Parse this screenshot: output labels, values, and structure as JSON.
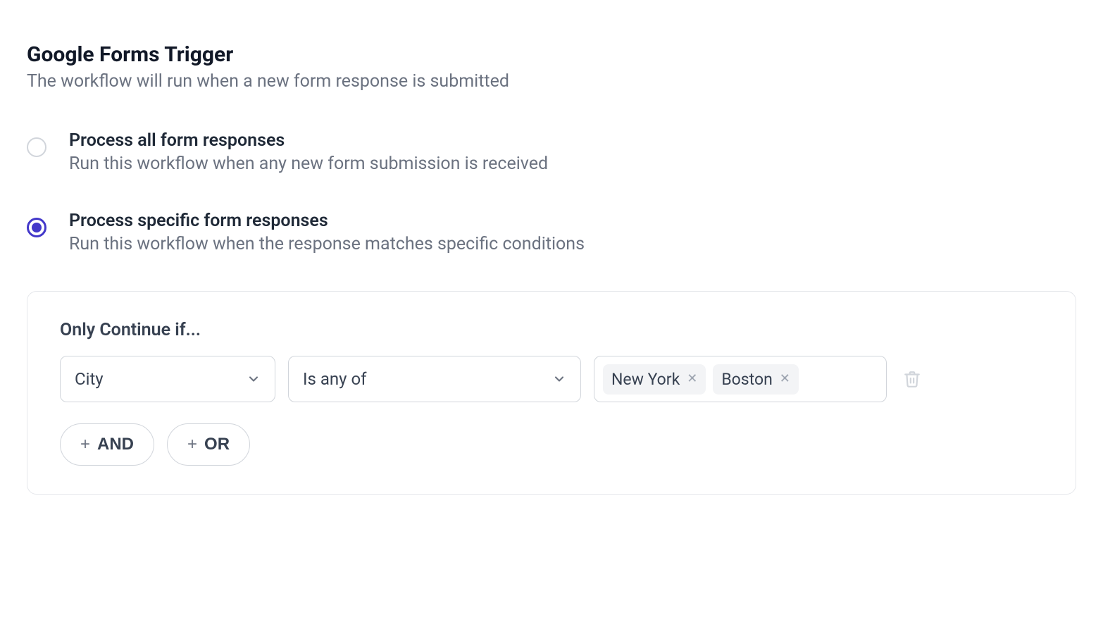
{
  "header": {
    "title": "Google Forms Trigger",
    "subtitle": "The workflow will run when a new form response is submitted"
  },
  "options": {
    "all": {
      "title": "Process all form responses",
      "desc": "Run this workflow when any new form submission is received",
      "selected": false
    },
    "specific": {
      "title": "Process specific form responses",
      "desc": "Run this workflow when the response matches specific conditions",
      "selected": true
    }
  },
  "conditions": {
    "panel_title": "Only Continue if...",
    "row": {
      "field": "City",
      "operator": "Is any of",
      "tags": [
        "New York",
        "Boston"
      ]
    },
    "add_and_label": "AND",
    "add_or_label": "OR"
  },
  "icons": {
    "chevron_down": "chevron-down",
    "trash": "trash",
    "plus": "+",
    "close": "✕"
  }
}
